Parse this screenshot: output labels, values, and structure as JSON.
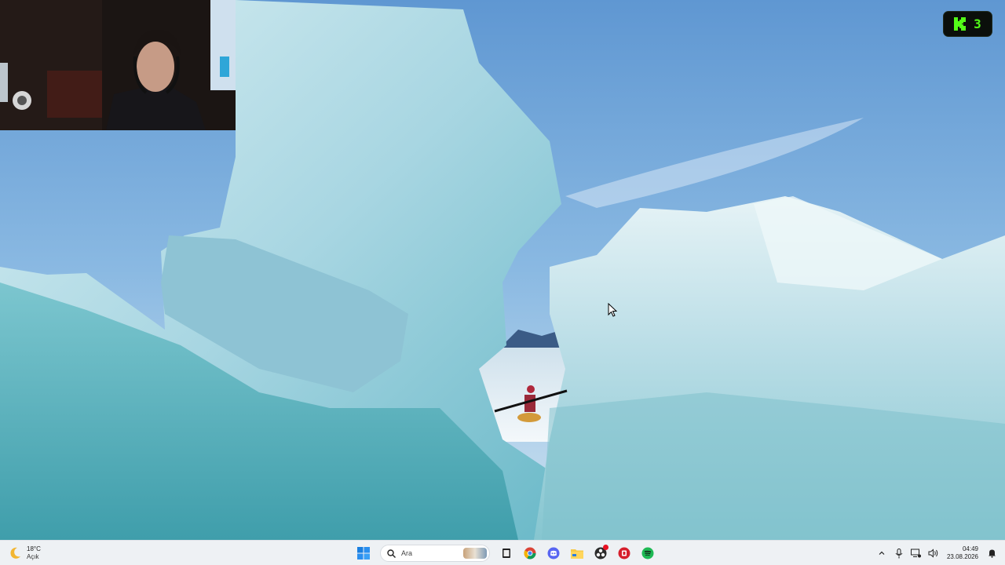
{
  "desktop": {
    "wallpaper": "glacier-ice-arch-with-kayaker"
  },
  "webcam_overlay": {
    "kind": "webcam-feed"
  },
  "kick_badge": {
    "icon": "kick-logo-icon",
    "count": "3",
    "accent": "#53fc18"
  },
  "taskbar": {
    "weather": {
      "icon": "moon-icon",
      "temperature": "18°C",
      "condition": "Açık"
    },
    "start_icon": "windows-start-icon",
    "search": {
      "placeholder": "Ara"
    },
    "pinned_apps": [
      {
        "name": "task-view-icon"
      },
      {
        "name": "chrome-icon"
      },
      {
        "name": "discord-icon"
      },
      {
        "name": "file-explorer-icon"
      },
      {
        "name": "obs-icon",
        "has_badge": true
      },
      {
        "name": "app-red-icon"
      },
      {
        "name": "spotify-icon"
      }
    ],
    "tray": {
      "icons": [
        "chevron-up-icon",
        "microphone-icon",
        "network-icon",
        "volume-icon"
      ],
      "time": "04:49",
      "date": "23.08.2026",
      "notification_icon": "notification-bell-icon"
    }
  },
  "colors": {
    "taskbar_bg": "#eef1f4",
    "sky": "#7fb3d9",
    "ice": "#bfe3ec",
    "water_teal": "#4fb3bf"
  }
}
